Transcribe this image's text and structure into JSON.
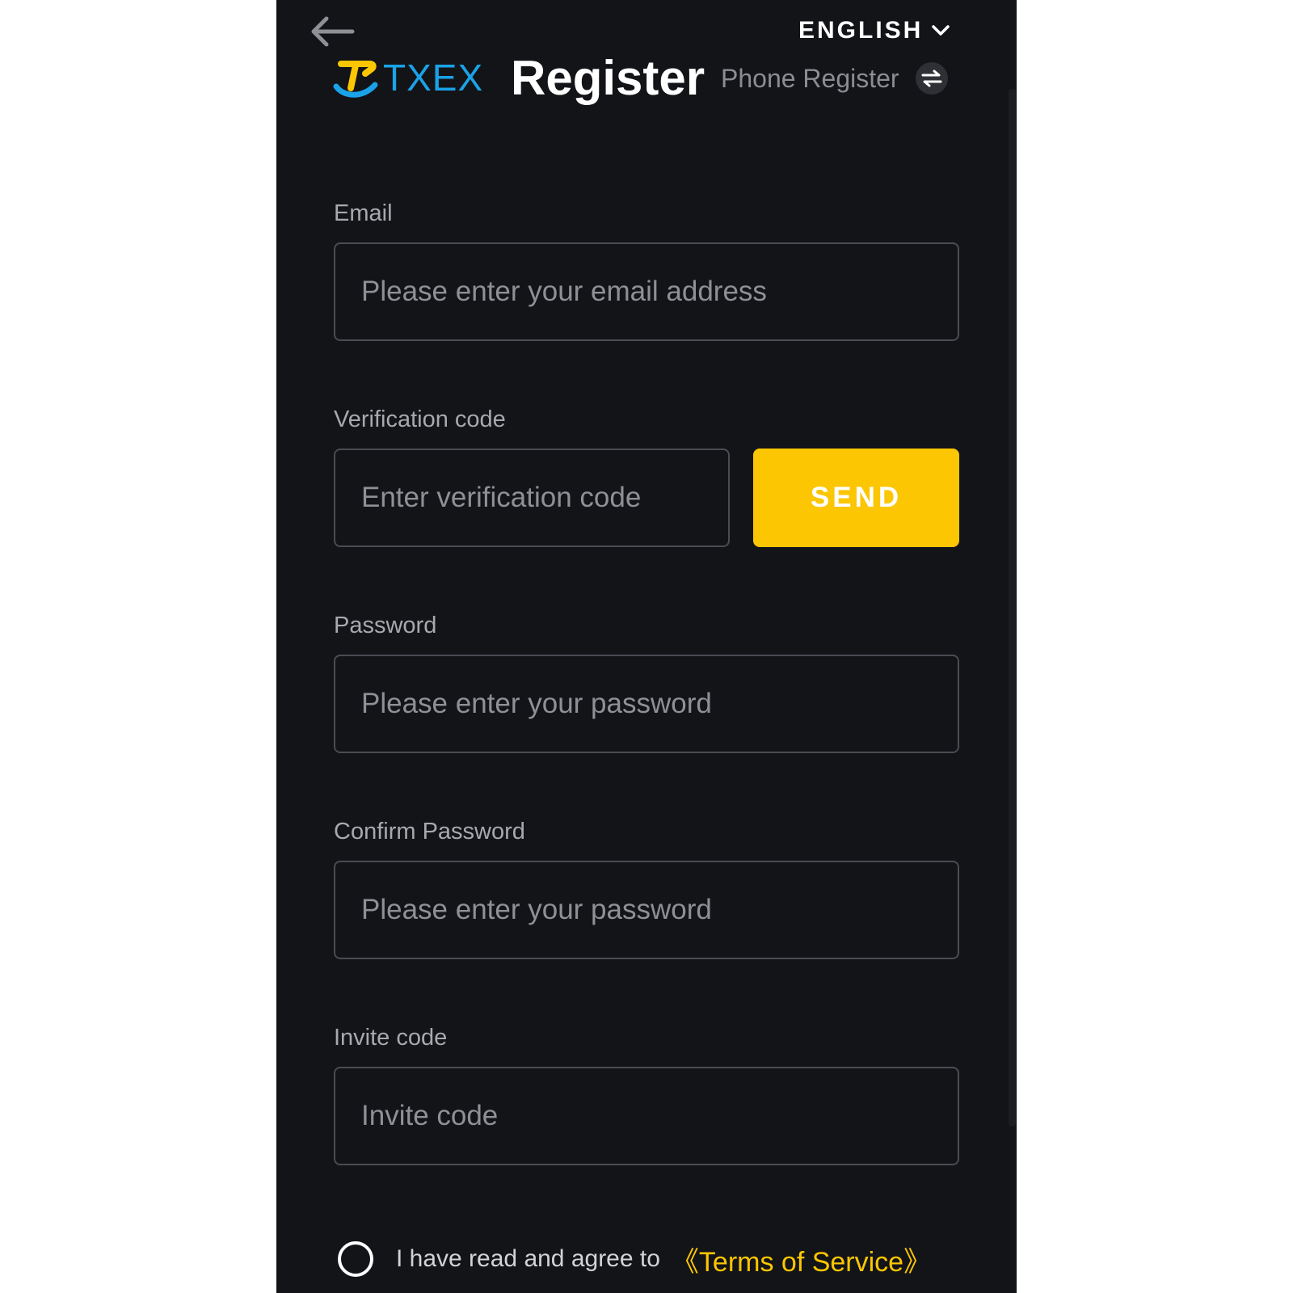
{
  "header": {
    "language": "ENGLISH",
    "brand": "TXEX",
    "title": "Register",
    "switch_label": "Phone Register"
  },
  "form": {
    "email": {
      "label": "Email",
      "placeholder": "Please enter your email address",
      "value": ""
    },
    "verification": {
      "label": "Verification code",
      "placeholder": "Enter verification code",
      "value": "",
      "send_label": "SEND"
    },
    "password": {
      "label": "Password",
      "placeholder": "Please enter your password",
      "value": ""
    },
    "confirm_password": {
      "label": "Confirm Password",
      "placeholder": "Please enter your password",
      "value": ""
    },
    "invite": {
      "label": "Invite code",
      "placeholder": "Invite code",
      "value": ""
    }
  },
  "agreement": {
    "text": "I have read and agree to",
    "link": "《Terms of Service》",
    "checked": false
  },
  "colors": {
    "background": "#131418",
    "accent": "#fcc602",
    "brand": "#1aa3e8"
  }
}
